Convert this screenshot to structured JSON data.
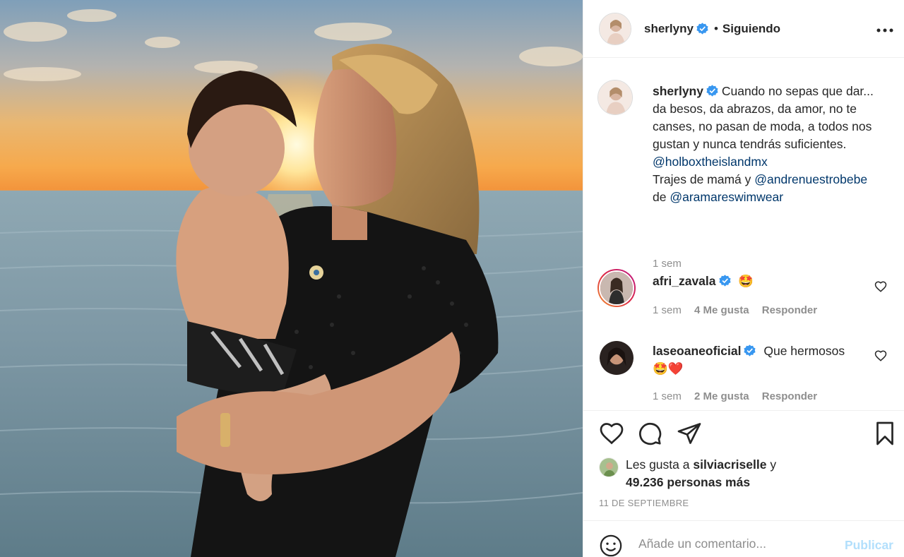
{
  "post": {
    "photo_alt": "",
    "author": "sherlyny",
    "follow_status": "Siguiendo",
    "separator": "•",
    "more_icon": "more-horizontal-icon"
  },
  "caption": {
    "username": "sherlyny",
    "text_1": "Cuando no sepas que dar... da besos, da abrazos, da amor, no te canses, no pasan de moda, a todos nos gustan y nunca tendrás suficientes.",
    "mention_1": "@holboxtheislandmx",
    "text_2": "Trajes de mamá y ",
    "mention_2": "@andrenuestrobebe",
    "text_3": "de ",
    "mention_3": "@aramareswimwear",
    "time": "1 sem"
  },
  "comments": [
    {
      "username": "afri_zavala",
      "text": "🤩",
      "time": "1 sem",
      "likes": "4 Me gusta",
      "reply": "Responder"
    },
    {
      "username": "laseoaneoficial",
      "text": "Que hermosos",
      "text_2": "🤩❤️",
      "time": "1 sem",
      "likes": "2 Me gusta",
      "reply": "Responder"
    }
  ],
  "likes": {
    "prefix": "Les gusta a ",
    "user": "silviacriselle",
    "suffix": " y",
    "count": "49.236 personas más"
  },
  "date": "11 DE SEPTIEMBRE",
  "comment_box": {
    "placeholder": "Añade un comentario...",
    "publish": "Publicar"
  },
  "colors": {
    "verified": "#3897f0",
    "link": "#00376b",
    "muted": "#8e8e8e",
    "publish_disabled": "#b2dffc"
  }
}
